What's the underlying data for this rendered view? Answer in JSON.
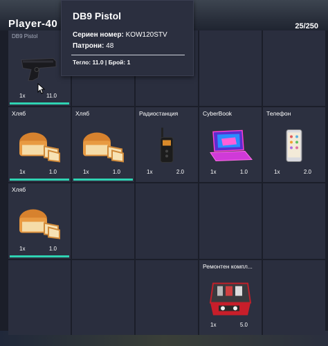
{
  "header": {
    "player_name": "Player-40",
    "capacity": "25/250"
  },
  "tooltip": {
    "title": "DB9 Pistol",
    "serial_label": "Сериен номер:",
    "serial_value": "KOW120STV",
    "ammo_label": "Патрони:",
    "ammo_value": "48",
    "footer": "Тегло: 11.0 | Брой: 1"
  },
  "slots": [
    {
      "name": "DB9 Pistol",
      "qty": "1x",
      "weight": "11.0",
      "icon": "pistol-icon",
      "bar": true
    },
    {
      "name": "Хляб",
      "qty": "1x",
      "weight": "1.0",
      "icon": "bread-icon",
      "bar": true
    },
    {
      "name": "Хляб",
      "qty": "1x",
      "weight": "1.0",
      "icon": "bread-icon",
      "bar": true
    },
    {
      "name": "Радиостанция",
      "qty": "1x",
      "weight": "2.0",
      "icon": "radio-icon",
      "bar": false
    },
    {
      "name": "CyberBook",
      "qty": "1x",
      "weight": "1.0",
      "icon": "laptop-icon",
      "bar": false
    },
    {
      "name": "Телефон",
      "qty": "1x",
      "weight": "2.0",
      "icon": "phone-icon",
      "bar": false
    },
    {
      "name": "Хляб",
      "qty": "1x",
      "weight": "1.0",
      "icon": "bread-icon",
      "bar": true
    },
    {
      "name": "Ремонтен компл...",
      "qty": "1x",
      "weight": "5.0",
      "icon": "repair-kit-icon",
      "bar": false
    }
  ],
  "colors": {
    "accent": "#2fd3b3",
    "panel": "#2a2e3e",
    "background": "#1b1e29"
  }
}
